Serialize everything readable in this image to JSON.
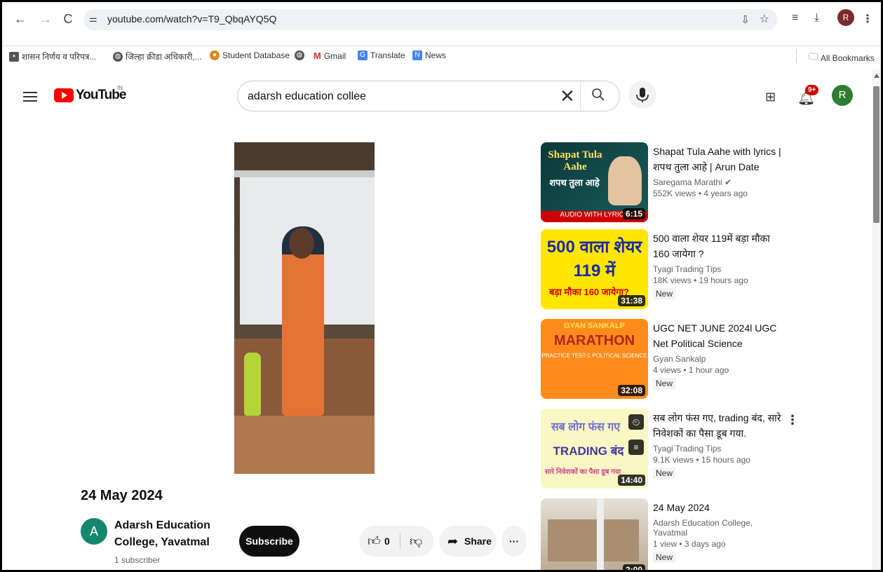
{
  "browser": {
    "url": "youtube.com/watch?v=T9_QbqAYQ5Q",
    "profile_initial": "R",
    "bookmarks": [
      {
        "label": "शासन निर्णय व परिपत्र...",
        "color": "#555555"
      },
      {
        "label": "जिल्हा क्रीडा अधिकारी,...",
        "color": "#555555"
      },
      {
        "label": "Student Database",
        "color": "#d88b1c"
      },
      {
        "label": "",
        "color": "#555555"
      },
      {
        "label": "Gmail",
        "color": "#d93025"
      },
      {
        "label": "Translate",
        "color": "#4285f4"
      },
      {
        "label": "News",
        "color": "#4285f4"
      }
    ],
    "all_bookmarks_label": "All Bookmarks"
  },
  "youtube": {
    "logo_text": "YouTube",
    "country_code": "IN",
    "search_query": "adarsh education collee",
    "notification_badge": "9+",
    "avatar_initial": "R"
  },
  "video": {
    "title": "24 May 2024",
    "channel_initial": "A",
    "channel_name": "Adarsh Education College, Yavatmal",
    "subscribers": "1 subscriber",
    "subscribe_label": "Subscribe",
    "like_count": "0",
    "share_label": "Share",
    "more_label": "···"
  },
  "recommendations": [
    {
      "title": "Shapat Tula Aahe with lyrics | शपथ तुला आहे | Arun Date",
      "channel": "Saregama Marathi",
      "verified": true,
      "meta": "552K views • 4 years ago",
      "duration": "6:15",
      "is_new": false,
      "thumb_text_1": "Shapat Tula Aahe",
      "thumb_text_2": "शपथ तुला आहे",
      "thumb_text_3": "AUDIO WITH LYRICS"
    },
    {
      "title": "500 वाला शेयर 119में बड़ा मौका 160 जायेगा ?",
      "channel": "Tyagi Trading Tips",
      "verified": false,
      "meta": "18K views • 19 hours ago",
      "duration": "31:38",
      "is_new": true,
      "new_label": "New",
      "thumb_text_1": "500 वाला शेयर",
      "thumb_text_2": "119 में",
      "thumb_text_3": "बड़ा मौका 160 जायेगा?"
    },
    {
      "title": "UGC NET JUNE 2024l UGC Net Political Science Marathon...",
      "channel": "Gyan Sankalp",
      "verified": false,
      "meta": "4 views • 1 hour ago",
      "duration": "32:08",
      "is_new": true,
      "new_label": "New",
      "thumb_text_1": "GYAN SANKALP",
      "thumb_text_2": "MARATHON",
      "thumb_text_3": "PRACTICE TEST-1 POLITICAL SCIENCE"
    },
    {
      "title": "सब लोग फंस गए, trading बंद, सारे निवेशकों का पैसा डूब गया.",
      "channel": "Tyagi Trading Tips",
      "verified": false,
      "meta": "9.1K views • 15 hours ago",
      "duration": "14:40",
      "is_new": true,
      "new_label": "New",
      "thumb_text_1": "सब लोग फंस गए",
      "thumb_text_2": "TRADING बंद",
      "thumb_text_3": "सारे निवेशकों का पैसा डूब गया"
    },
    {
      "title": "24 May 2024",
      "channel": "Adarsh Education College, Yavatmal",
      "verified": false,
      "meta": "1 view • 3 days ago",
      "duration": "2:00",
      "is_new": true,
      "new_label": "New"
    }
  ]
}
